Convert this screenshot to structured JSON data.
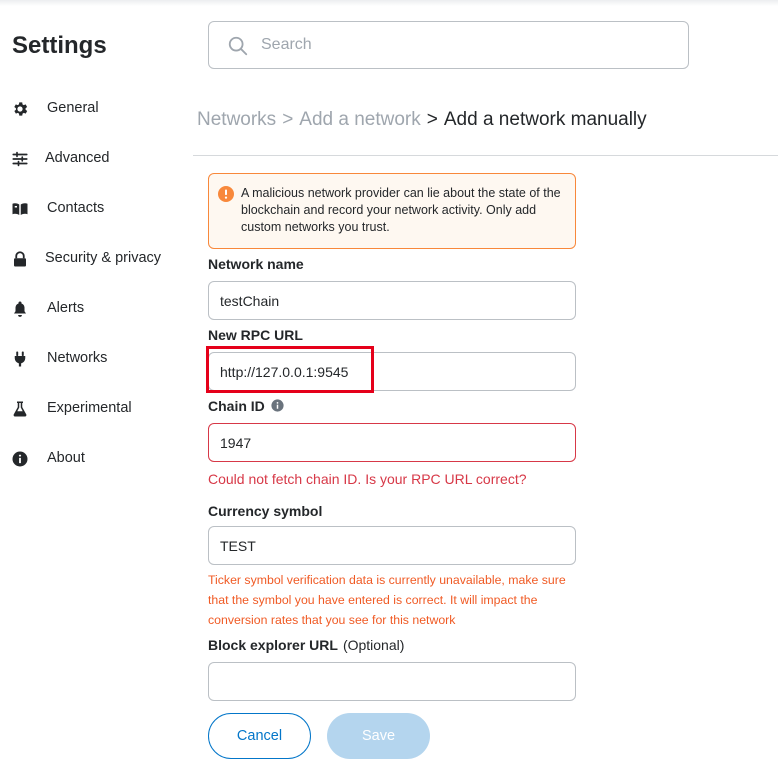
{
  "app": {
    "title": "Settings"
  },
  "sidebar": {
    "items": [
      {
        "label": "General",
        "icon": "gear-icon"
      },
      {
        "label": "Advanced",
        "icon": "sliders-icon"
      },
      {
        "label": "Contacts",
        "icon": "book-icon"
      },
      {
        "label": "Security & privacy",
        "icon": "lock-icon"
      },
      {
        "label": "Alerts",
        "icon": "bell-icon"
      },
      {
        "label": "Networks",
        "icon": "plug-icon"
      },
      {
        "label": "Experimental",
        "icon": "flask-icon"
      },
      {
        "label": "About",
        "icon": "info-icon"
      }
    ]
  },
  "search": {
    "placeholder": "Search",
    "value": ""
  },
  "breadcrumb": {
    "items": [
      "Networks",
      "Add a network"
    ],
    "separator": ">",
    "current": "Add a network manually"
  },
  "warning": {
    "text": "A malicious network provider can lie about the state of the blockchain and record your network activity. Only add custom networks you trust.",
    "color": "#f8883b"
  },
  "form": {
    "network_name": {
      "label": "Network name",
      "value": "testChain"
    },
    "rpc_url": {
      "label": "New RPC URL",
      "value": "http://127.0.0.1:9545"
    },
    "chain_id": {
      "label": "Chain ID",
      "value": "1947",
      "error": "Could not fetch chain ID. Is your RPC URL correct?"
    },
    "currency_symbol": {
      "label": "Currency symbol",
      "value": "TEST",
      "warning": "Ticker symbol verification data is currently unavailable, make sure that the symbol you have entered is correct. It will impact the conversion rates that you see for this network"
    },
    "block_explorer": {
      "label": "Block explorer URL",
      "optional": "(Optional)",
      "value": ""
    }
  },
  "buttons": {
    "cancel": "Cancel",
    "save": "Save"
  },
  "colors": {
    "primary": "#0376c9",
    "error": "#d73847",
    "warning": "#f05a24",
    "highlight": "#e5001a"
  }
}
